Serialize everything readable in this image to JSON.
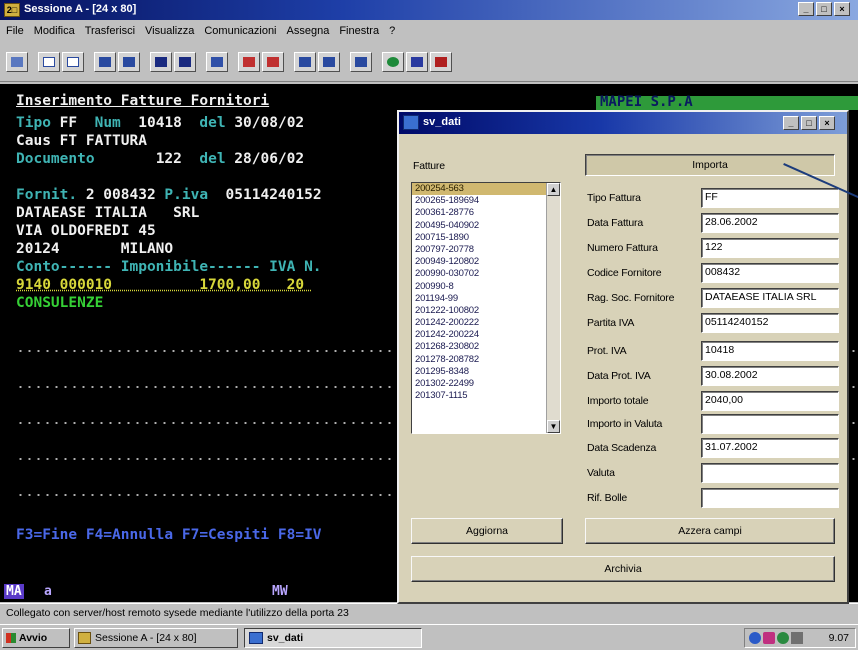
{
  "window": {
    "title": "Sessione A - [24 x 80]",
    "icon_label": "2□",
    "controls": [
      "_",
      "□",
      "×"
    ]
  },
  "menu": [
    "File",
    "Modifica",
    "Trasferisci",
    "Visualizza",
    "Comunicazioni",
    "Assegna",
    "Finestra",
    "?"
  ],
  "toolbar": {
    "icons": [
      "print-icon",
      "copy-icon",
      "paste-icon",
      "send-icon",
      "receive-icon",
      "screen-icon",
      "screen2-icon",
      "chart-icon",
      "macro-icon",
      "macro2-icon",
      "record-icon",
      "play-icon",
      "doc-icon",
      "globe-icon",
      "palette-icon",
      "key-icon"
    ]
  },
  "terminal": {
    "heading": "Inserimento Fatture Fornitori",
    "company": "MAPEI S.P.A",
    "tipo_label": "Tipo",
    "tipo_value": "FF",
    "num_label": "Num",
    "num_value": "10418",
    "del_label": "del",
    "del_value": "30/08/02",
    "caus_line": "Caus FT FATTURA",
    "doc_label": "Documento",
    "doc_value": "122",
    "doc_del_label": "del",
    "doc_del_value": "28/06/02",
    "fornit_label": "Fornit.",
    "fornit_value": "2 008432",
    "piva_label": "P.iva",
    "piva_value": "05114240152",
    "address_1": "DATAEASE ITALIA   SRL",
    "address_2": "VIA OLDOFREDI 45",
    "address_3": "20124       MILANO",
    "conto_header": "Conto------ Imponibile------ IVA N.",
    "conto_row": "9140 000010          1700,00   20 ",
    "conto_desc": "CONSULENZE",
    "fkeys": "F3=Fine F4=Annulla F7=Cespiti F8=IV"
  },
  "status_line": {
    "mode": "MA",
    "session": "a",
    "mw": "MW",
    "cursor": "0"
  },
  "info_bar": "Collegato con server/host remoto sysede mediante l'utilizzo della porta 23",
  "taskbar": {
    "start": "Avvio",
    "items": [
      "Sessione A - [24 x 80]",
      "sv_dati"
    ],
    "clock": "9.07"
  },
  "dialog": {
    "title": "sv_dati",
    "list_label": "Fatture",
    "invoices": [
      "200254-563",
      "200265-189694",
      "200361-28776",
      "200495-040902",
      "200715-1890",
      "200797-20778",
      "200949-120802",
      "200990-030702",
      "200990-8",
      "201194-99",
      "201222-100802",
      "201242-200222",
      "201242-200224",
      "201268-230802",
      "201278-208782",
      "201295-8348",
      "201302-22499",
      "201307-1115"
    ],
    "selected_invoice": "200254-563",
    "import_button": "Importa",
    "fields": [
      {
        "label": "Tipo Fattura",
        "value": "FF"
      },
      {
        "label": "Data Fattura",
        "value": "28.06.2002"
      },
      {
        "label": "Numero Fattura",
        "value": "122"
      },
      {
        "label": "Codice Fornitore",
        "value": "008432"
      },
      {
        "label": "Rag. Soc. Fornitore",
        "value": "DATAEASE ITALIA  SRL"
      },
      {
        "label": "Partita IVA",
        "value": "05114240152"
      },
      {
        "label": "Prot. IVA",
        "value": "10418"
      },
      {
        "label": "Data Prot. IVA",
        "value": "30.08.2002"
      },
      {
        "label": "Importo totale",
        "value": "2040,00"
      },
      {
        "label": "Importo in Valuta",
        "value": ""
      },
      {
        "label": "Data Scadenza",
        "value": "31.07.2002"
      },
      {
        "label": "Valuta",
        "value": ""
      },
      {
        "label": "Rif. Bolle",
        "value": ""
      }
    ],
    "aggiorna_button": "Aggiorna",
    "azzera_button": "Azzera campi",
    "archivia_button": "Archivia"
  }
}
